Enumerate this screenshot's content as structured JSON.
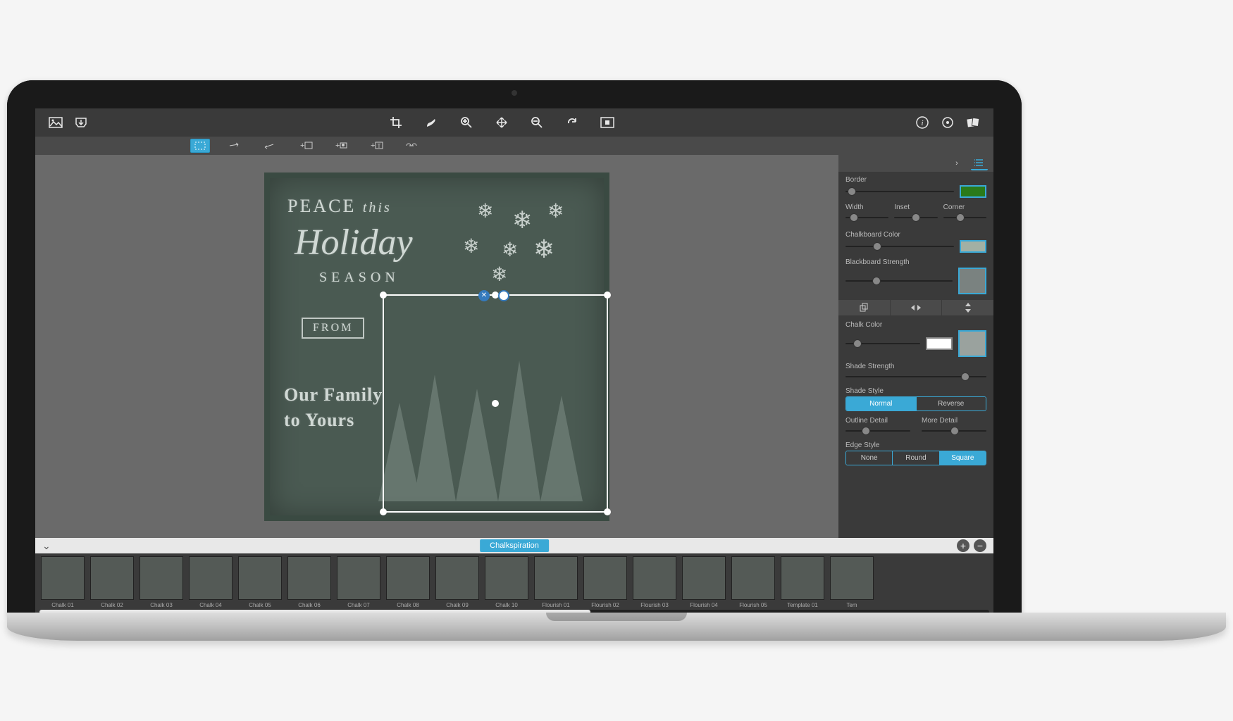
{
  "app": {
    "preset_name": "Chalkspiration"
  },
  "canvas": {
    "text_line1_a": "PEACE",
    "text_line1_b": "this",
    "text_line2": "Holiday",
    "text_line3": "SEASON",
    "text_from": "FROM",
    "text_line4": "Our Family\nto Yours"
  },
  "panel": {
    "border_label": "Border",
    "border_color": "#2a7a1a",
    "width_label": "Width",
    "inset_label": "Inset",
    "corner_label": "Corner",
    "chalkboard_color_label": "Chalkboard Color",
    "chalkboard_color": "#a2b0a4",
    "blackboard_strength_label": "Blackboard Strength",
    "chalk_color_label": "Chalk Color",
    "chalk_color": "#ffffff",
    "shade_strength_label": "Shade Strength",
    "shade_style_label": "Shade Style",
    "shade_style_options": {
      "normal": "Normal",
      "reverse": "Reverse"
    },
    "outline_detail_label": "Outline Detail",
    "more_detail_label": "More Detail",
    "edge_style_label": "Edge Style",
    "edge_style_options": {
      "none": "None",
      "round": "Round",
      "square": "Square"
    }
  },
  "thumbnails": [
    "Chalk 01",
    "Chalk 02",
    "Chalk 03",
    "Chalk 04",
    "Chalk 05",
    "Chalk 06",
    "Chalk 07",
    "Chalk 08",
    "Chalk 09",
    "Chalk 10",
    "Flourish 01",
    "Flourish 02",
    "Flourish 03",
    "Flourish 04",
    "Flourish 05",
    "Template 01",
    "Tem"
  ]
}
